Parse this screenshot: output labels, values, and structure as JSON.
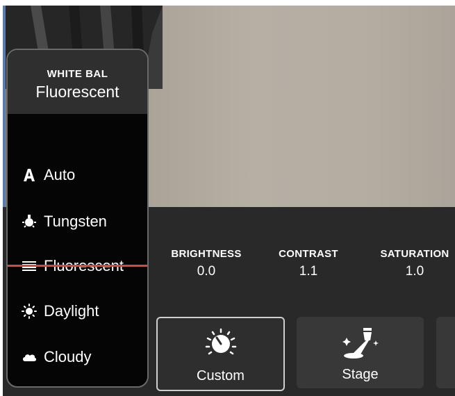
{
  "white_balance_panel": {
    "title": "WHITE BAL",
    "current_value": "Fluorescent",
    "options": [
      {
        "label": "Auto",
        "icon": "auto-letter-icon"
      },
      {
        "label": "Tungsten",
        "icon": "tungsten-bulb-icon"
      },
      {
        "label": "Fluorescent",
        "icon": "fluorescent-tube-icon",
        "selected": true
      },
      {
        "label": "Daylight",
        "icon": "sun-icon"
      },
      {
        "label": "Cloudy",
        "icon": "cloud-icon"
      }
    ],
    "selection_color": "#e0453a"
  },
  "adjustments": [
    {
      "label": "BRIGHTNESS",
      "value": "0.0"
    },
    {
      "label": "CONTRAST",
      "value": "1.1"
    },
    {
      "label": "SATURATION",
      "value": "1.0"
    }
  ],
  "modes": [
    {
      "label": "Custom",
      "icon": "dial-icon",
      "selected": true
    },
    {
      "label": "Stage",
      "icon": "spotlight-icon"
    }
  ]
}
